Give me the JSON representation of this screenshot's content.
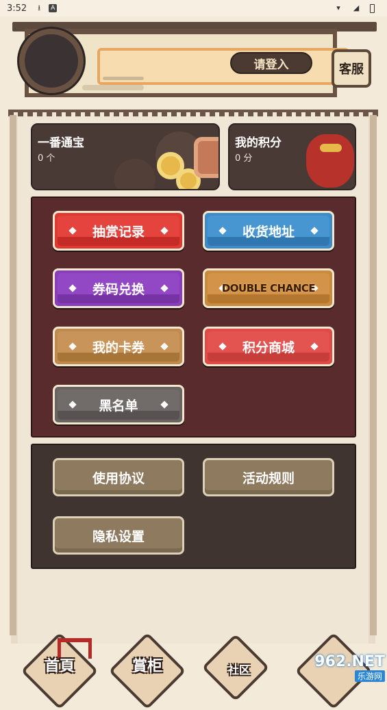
{
  "status_bar": {
    "time": "3:52",
    "icons": [
      "download-icon",
      "a-icon"
    ],
    "right_icons": [
      "wifi-icon",
      "signal-icon",
      "battery-icon"
    ]
  },
  "header": {
    "login_label": "请登入",
    "service_label": "客服"
  },
  "assets": [
    {
      "title": "一番通宝",
      "value": "0 个"
    },
    {
      "title": "我的积分",
      "value": "0 分"
    }
  ],
  "menu": {
    "items": [
      {
        "label": "抽赏记录",
        "color": "#de3a34"
      },
      {
        "label": "收货地址",
        "color": "#3d8bc7"
      },
      {
        "label": "券码兑换",
        "color": "#8a3fba"
      },
      {
        "label": "DOUBLE CHANCE",
        "color": "#c98c3c"
      },
      {
        "label": "我的卡券",
        "color": "#bf8a4d"
      },
      {
        "label": "积分商城",
        "color": "#e04a48"
      },
      {
        "label": "黑名单",
        "color": "#6a6563"
      }
    ]
  },
  "settings": {
    "items": [
      {
        "label": "使用协议"
      },
      {
        "label": "活动规则"
      },
      {
        "label": "隐私设置"
      }
    ]
  },
  "bottom_nav": {
    "items": [
      {
        "label": "首頁"
      },
      {
        "label": "賞柜"
      },
      {
        "label": "社区"
      },
      {
        "label": ""
      }
    ]
  },
  "watermark": {
    "line1": "962.NET",
    "line2": "乐游网"
  }
}
